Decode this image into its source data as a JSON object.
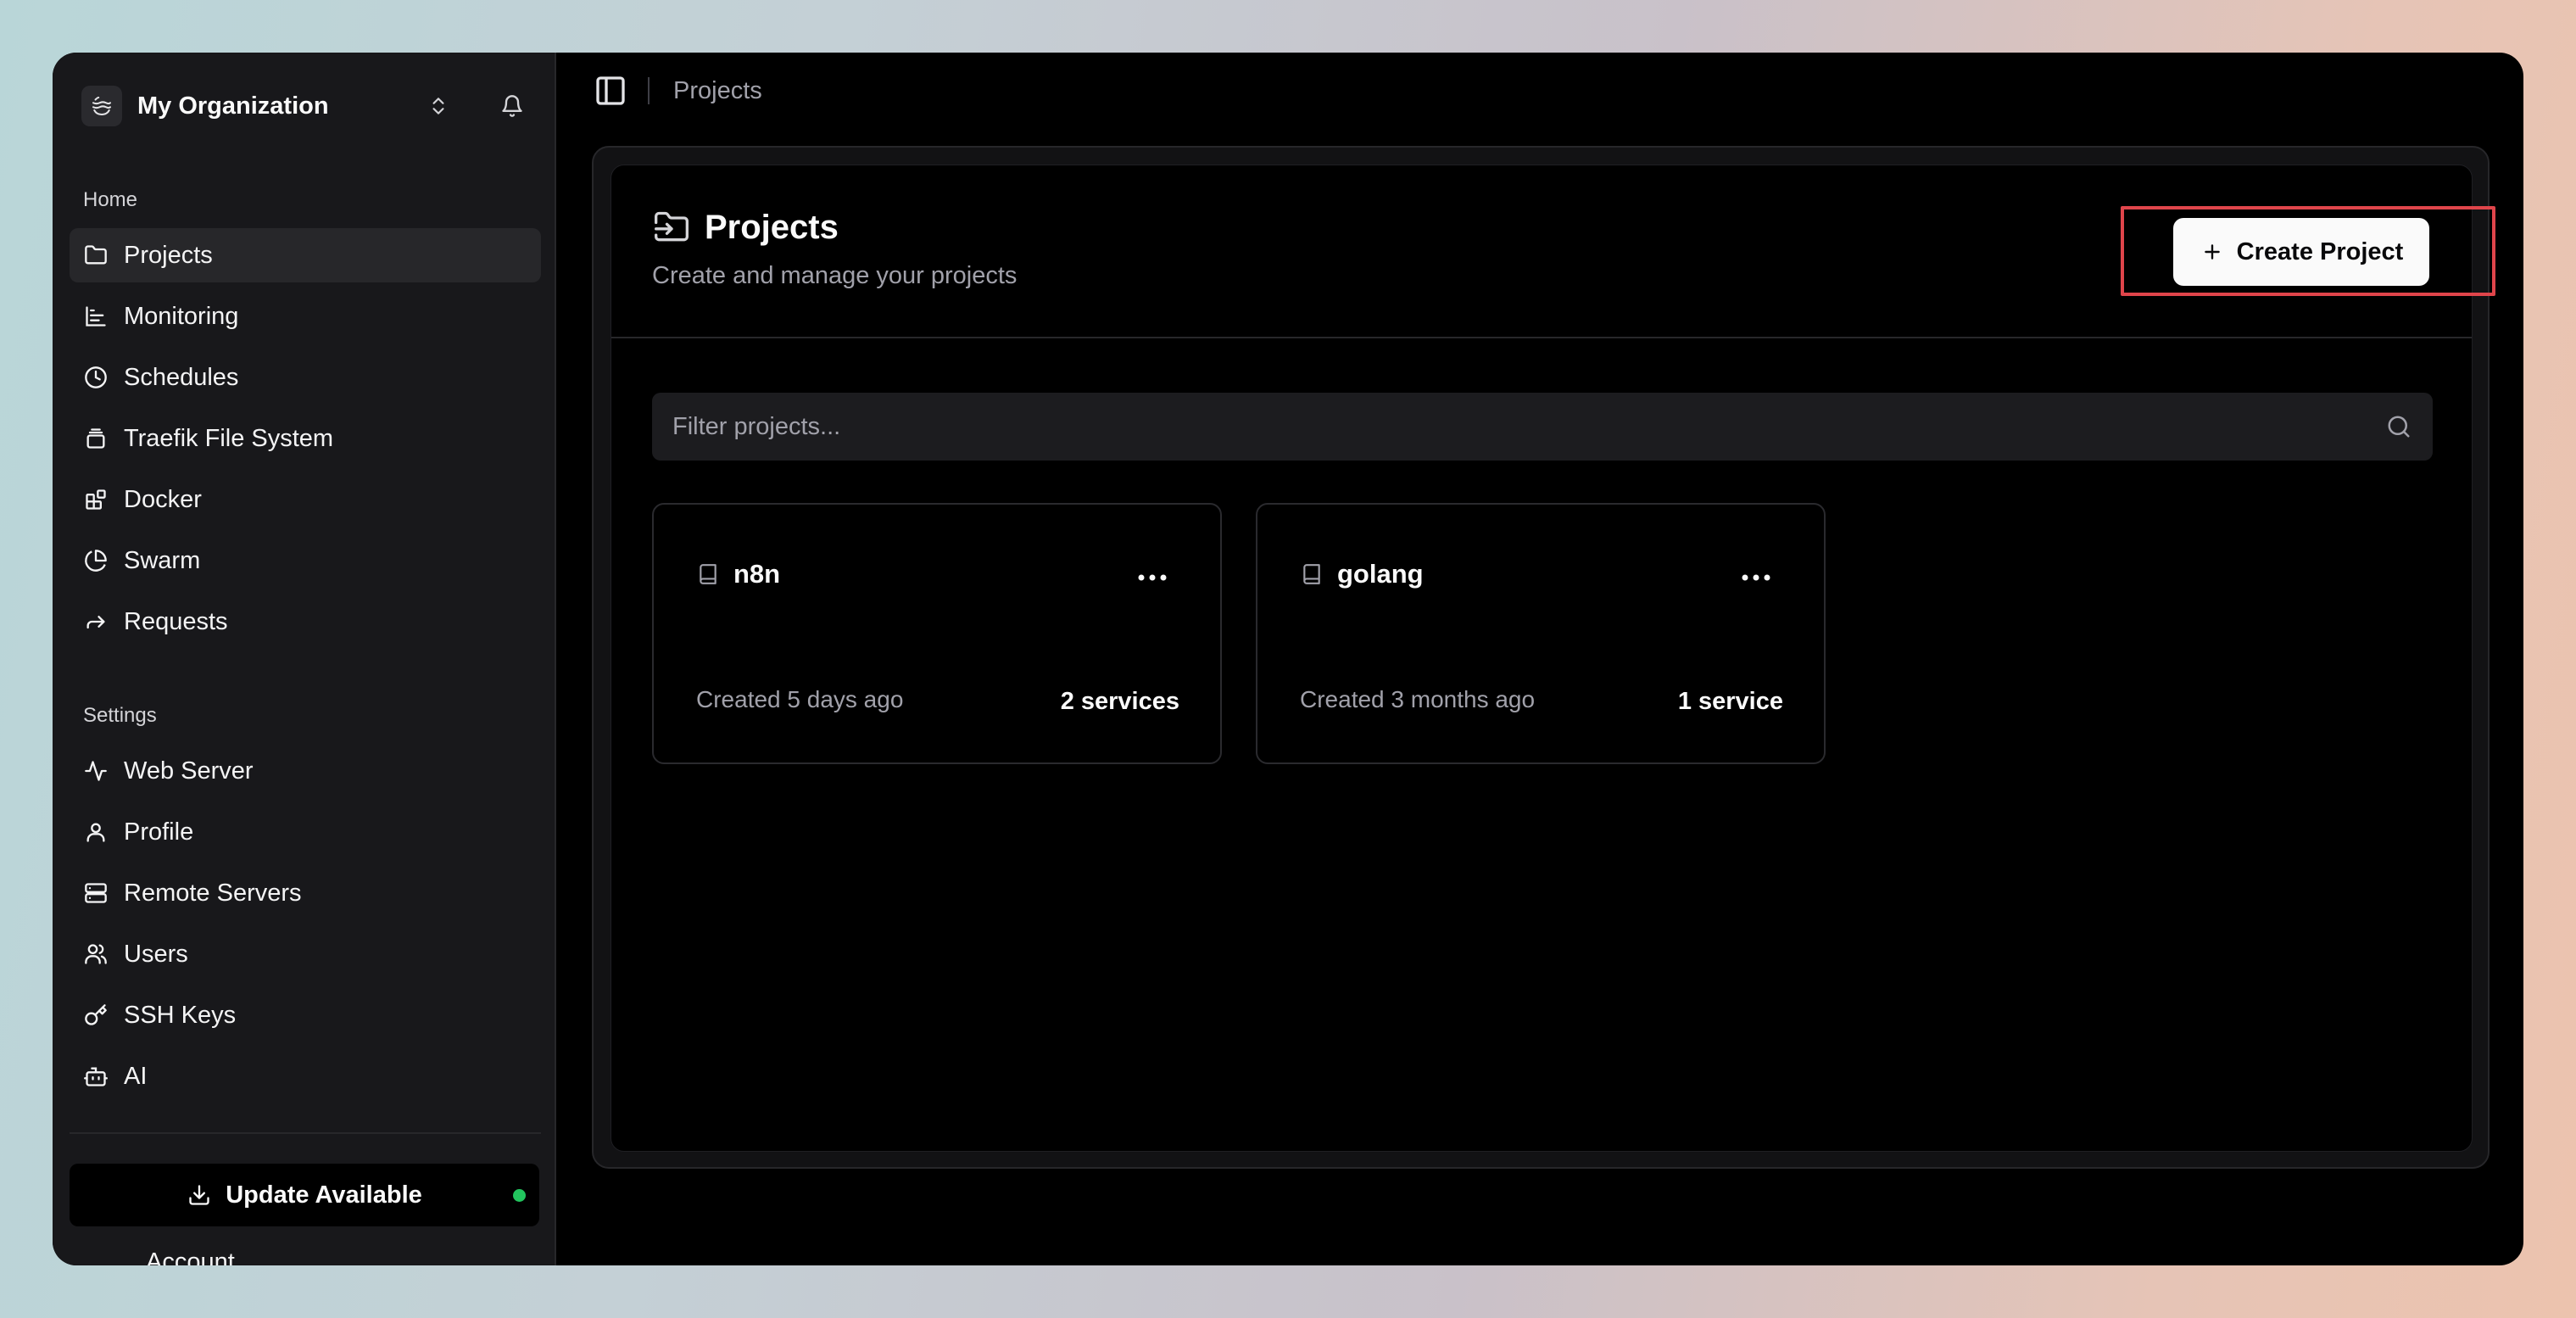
{
  "sidebar": {
    "org_name": "My Organization",
    "home_section": "Home",
    "home_items": [
      {
        "label": "Projects",
        "icon": "folder-icon",
        "active": true
      },
      {
        "label": "Monitoring",
        "icon": "chart-icon"
      },
      {
        "label": "Schedules",
        "icon": "clock-icon"
      },
      {
        "label": "Traefik File System",
        "icon": "layers-icon"
      },
      {
        "label": "Docker",
        "icon": "blocks-icon"
      },
      {
        "label": "Swarm",
        "icon": "pie-chart-icon"
      },
      {
        "label": "Requests",
        "icon": "forward-arrow-icon"
      }
    ],
    "settings_section": "Settings",
    "settings_items": [
      {
        "label": "Web Server",
        "icon": "activity-icon"
      },
      {
        "label": "Profile",
        "icon": "user-icon"
      },
      {
        "label": "Remote Servers",
        "icon": "server-icon"
      },
      {
        "label": "Users",
        "icon": "users-icon"
      },
      {
        "label": "SSH Keys",
        "icon": "key-icon"
      },
      {
        "label": "AI",
        "icon": "bot-icon"
      }
    ],
    "update_label": "Update Available",
    "cut_off_text": "Account"
  },
  "topbar": {
    "breadcrumb": "Projects"
  },
  "page": {
    "title": "Projects",
    "subtitle": "Create and manage your projects",
    "create_label": "Create Project",
    "filter_placeholder": "Filter projects..."
  },
  "projects": [
    {
      "name": "n8n",
      "created": "Created 5 days ago",
      "services": "2 services"
    },
    {
      "name": "golang",
      "created": "Created 3 months ago",
      "services": "1 service"
    }
  ],
  "colors": {
    "highlight": "#e0454b",
    "status_dot": "#22c55e",
    "sidebar_bg": "#18181b"
  }
}
